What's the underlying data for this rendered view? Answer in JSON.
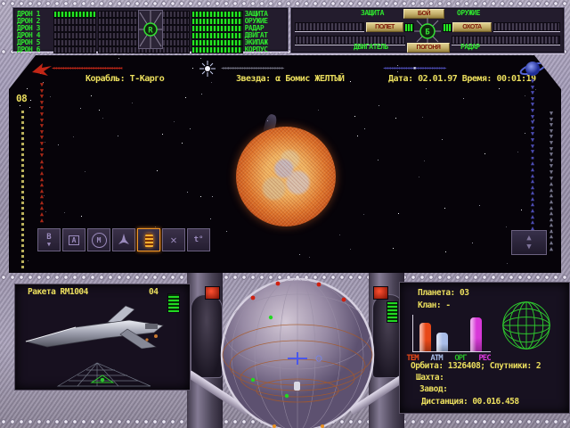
{
  "top_left_panel": {
    "emblem": "R",
    "rows": [
      {
        "drone": "ДРОН 1",
        "system": "ЗАЩИТА",
        "charged": true
      },
      {
        "drone": "ДРОН 2",
        "system": "ОРУЖИЕ",
        "charged": false
      },
      {
        "drone": "ДРОН 3",
        "system": "РАДАР",
        "charged": false
      },
      {
        "drone": "ДРОН 4",
        "system": "ДВИГАТ",
        "charged": false
      },
      {
        "drone": "ДРОН 5",
        "system": "ЭКИПАЖ",
        "charged": false
      },
      {
        "drone": "ДРОН 6",
        "system": "КОРПУС",
        "charged": false
      }
    ]
  },
  "top_right_panel": {
    "label_defense": "ЗАЩИТА",
    "label_weapons": "ОРУЖИЕ",
    "label_engine": "ДВИГАТЕЛЬ",
    "label_radar": "РАДАР",
    "btn_battle": "БОЙ",
    "btn_flight": "ПОЛЕТ",
    "btn_hunt": "ОХОТА",
    "btn_chase": "ПОГОНЯ",
    "emblem": "Б"
  },
  "status_bar": {
    "ship": "Корабль: Т-Карго",
    "star": "Звезда: α Бомис ЖЕЛТЫЙ",
    "datetime": "Дата: 02.01.97 Время: 00:01:19",
    "red_arrows": "◄◄◄◄◄◄◄◄◄◄◄◄◄◄◄◄◄◄◄◄◄◄◄◄◄◄◄◄◄◄",
    "gray_arrows": "◄◄◄►►►►►►►►►►►►►►►►►►►►►►►►",
    "blue_arrows_left": "◄◄◄◄◄◄◄◄◄◄◄◄◄",
    "blue_marker": "▪",
    "blue_arrows_right": "►►►►►►►►►►►►►"
  },
  "side_gauges": {
    "left_label": "08",
    "red_column": "▼\n▼\n▼\n▼\n▼\n▼\n▼\n▼\n▼\n▼\n▼\n▼\n▼\n▲\n▲\n▲\n▲\n▲\n▲\n▲\n▲\n▲\n▲\n▲",
    "blue_column": "▼\n▼\n▼\n▼\n▼\n▼\n▼\n▼\n▼\n▼\n▼\n▼\n▼\n▪\n▲\n▲\n▲\n▲\n▲\n▲\n▲\n▲\n▲\n▲\n▲\n▲\n▲",
    "gray_column": "▼\n▼\n▼\n▼\n▼\n▼\n▼\n▼\n▼\n▼\n▼\n▼\n▲\n▲\n▲\n▲\n▲\n▲\n▲\n▲\n▲\n▲\n▲\n▲"
  },
  "toolbar": {
    "icons": [
      {
        "name": "b-eject-icon",
        "glyph": "B",
        "arrow": "▼"
      },
      {
        "name": "chip-a-icon",
        "glyph": "A"
      },
      {
        "name": "target-m-icon",
        "glyph": "M"
      },
      {
        "name": "ship-icon",
        "glyph": ""
      },
      {
        "name": "thruster-icon",
        "glyph": "",
        "active": true
      },
      {
        "name": "move-cross-icon",
        "glyph": "✕"
      },
      {
        "name": "temperature-icon",
        "glyph": "t°"
      }
    ],
    "updown_up": "▲",
    "updown_down": "▼"
  },
  "left_screen": {
    "title": "Ракета RM1004",
    "count": "04"
  },
  "right_screen": {
    "planet": "Планета: 03",
    "clan": "Клан: -",
    "orbit": "Орбита: 1326408; Спутники: 2",
    "mine": "Шахта:",
    "factory": "Завод:",
    "distance": "Дистанция: 00.016.458",
    "chart": {
      "type": "bar",
      "title": "planet-parameters",
      "categories": [
        "ТЕМ",
        "АТМ",
        "ОРГ",
        "РЕС"
      ],
      "values": [
        85,
        55,
        0,
        100
      ],
      "max": 100,
      "colors": [
        "#e84818",
        "#a8bce8",
        "#28b828",
        "#d838d8"
      ]
    }
  }
}
